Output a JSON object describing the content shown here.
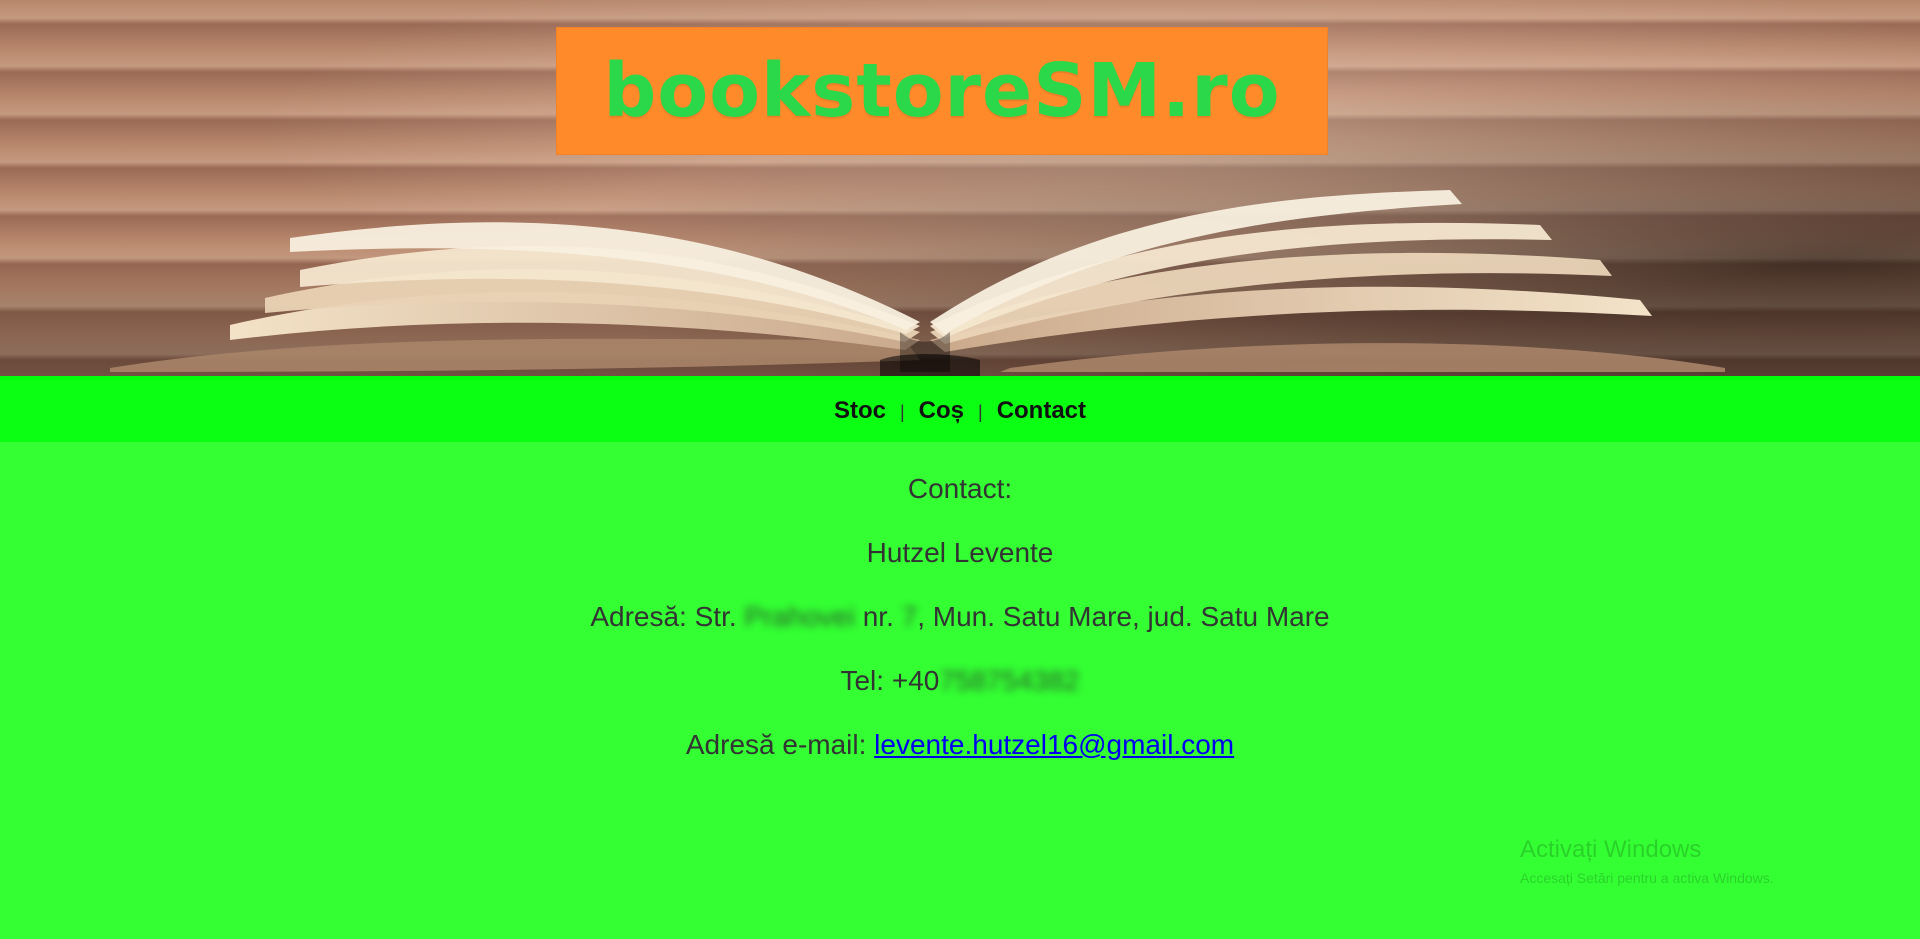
{
  "header": {
    "logo_text": "bookstoreSM.ro"
  },
  "nav": {
    "items": [
      {
        "label": "Stoc"
      },
      {
        "label": "Coș"
      },
      {
        "label": "Contact"
      }
    ],
    "separator": "|"
  },
  "contact": {
    "title": "Contact:",
    "name": "Hutzel Levente",
    "address": {
      "prefix": "Adresă: Str.",
      "street_redacted": "Prahovei",
      "nr_label": "nr.",
      "nr_redacted": "7",
      "suffix": ", Mun. Satu Mare, jud. Satu Mare"
    },
    "phone": {
      "prefix": "Tel: +40",
      "number_redacted": "758754382"
    },
    "email": {
      "label": "Adresă e-mail:",
      "value": "levente.hutzel16@gmail.com"
    }
  },
  "watermark": {
    "line1": "Activați Windows",
    "line2": "Accesați Setări pentru a activa Windows."
  },
  "colors": {
    "page_bg": "#33ff33",
    "nav_bg": "#0bff13",
    "logo_bg": "#ff8a2a",
    "logo_text": "#2bd84a",
    "link": "#0000ee"
  }
}
